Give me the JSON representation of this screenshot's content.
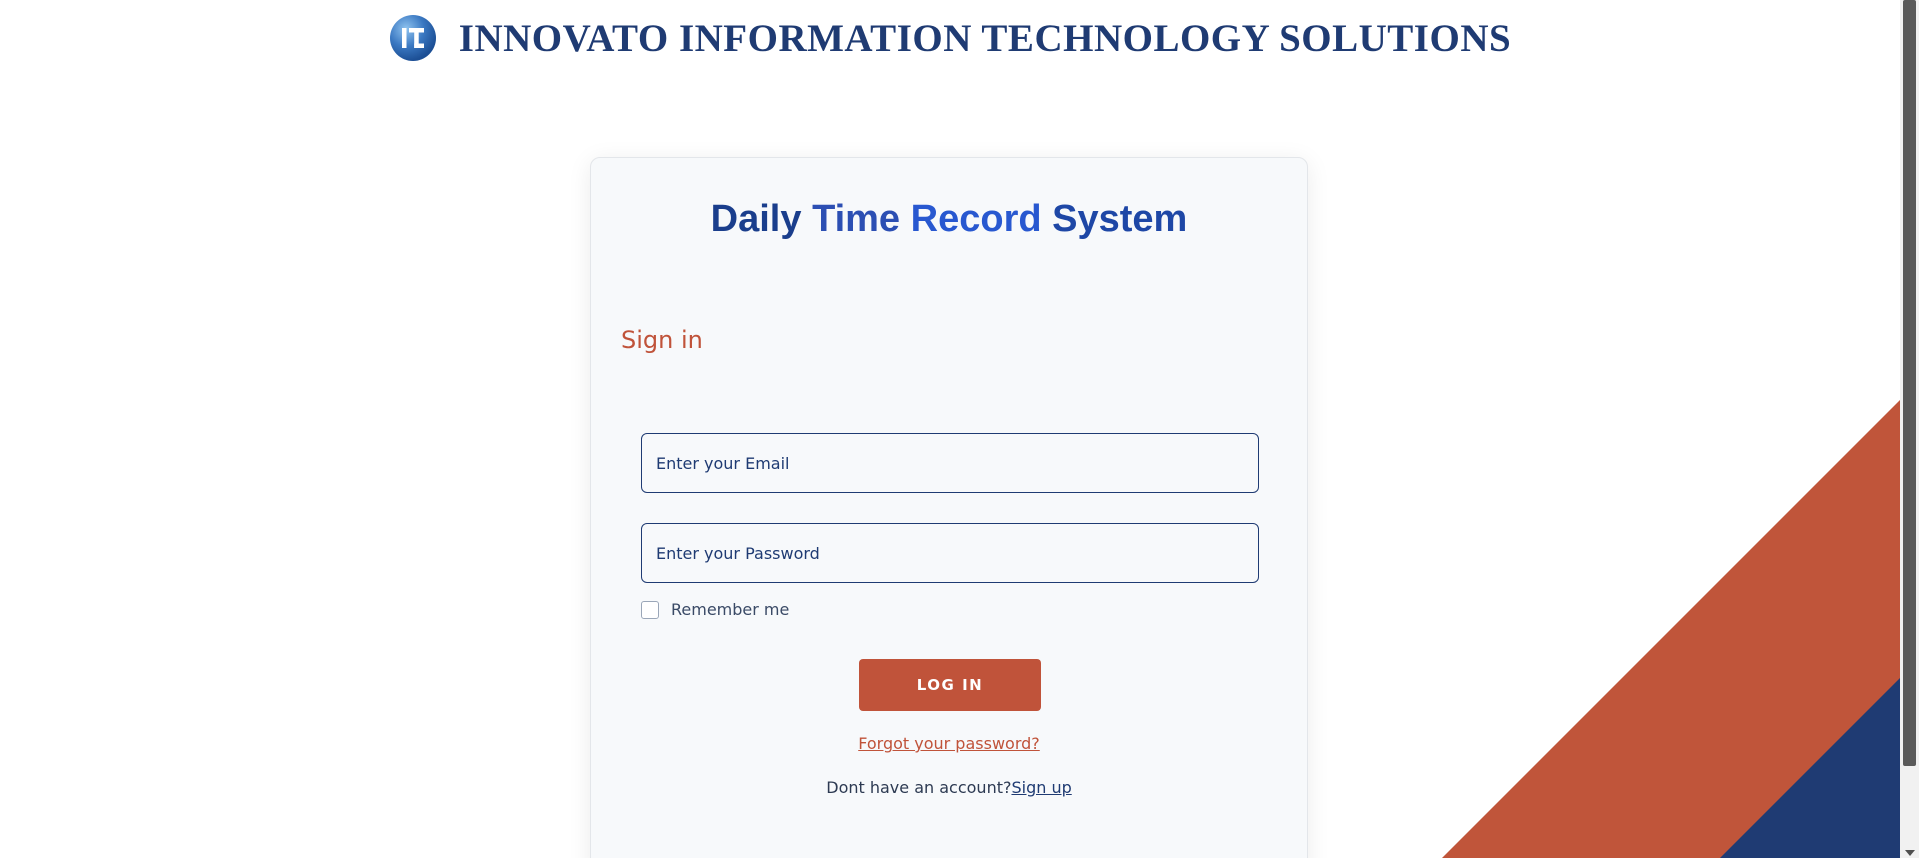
{
  "header": {
    "logo_icon": "innovato-logo-icon",
    "company_name": "INNOVATO INFORMATION TECHNOLOGY SOLUTIONS"
  },
  "login_card": {
    "title_words": [
      "Daily",
      "Time",
      "Record",
      "System"
    ],
    "signin_heading": "Sign in",
    "email_placeholder": "Enter your Email",
    "password_placeholder": "Enter your Password",
    "remember_label": "Remember me",
    "remember_checked": false,
    "login_label": "LOG IN",
    "forgot_label": "Forgot your password?",
    "no_account_text": "Dont have an account?",
    "signup_label": "Sign up"
  },
  "colors": {
    "brand_navy": "#1f3b73",
    "accent_orange": "#c0533a",
    "card_background": "#f7f9fb",
    "decor_navy": "#1f3b73"
  }
}
